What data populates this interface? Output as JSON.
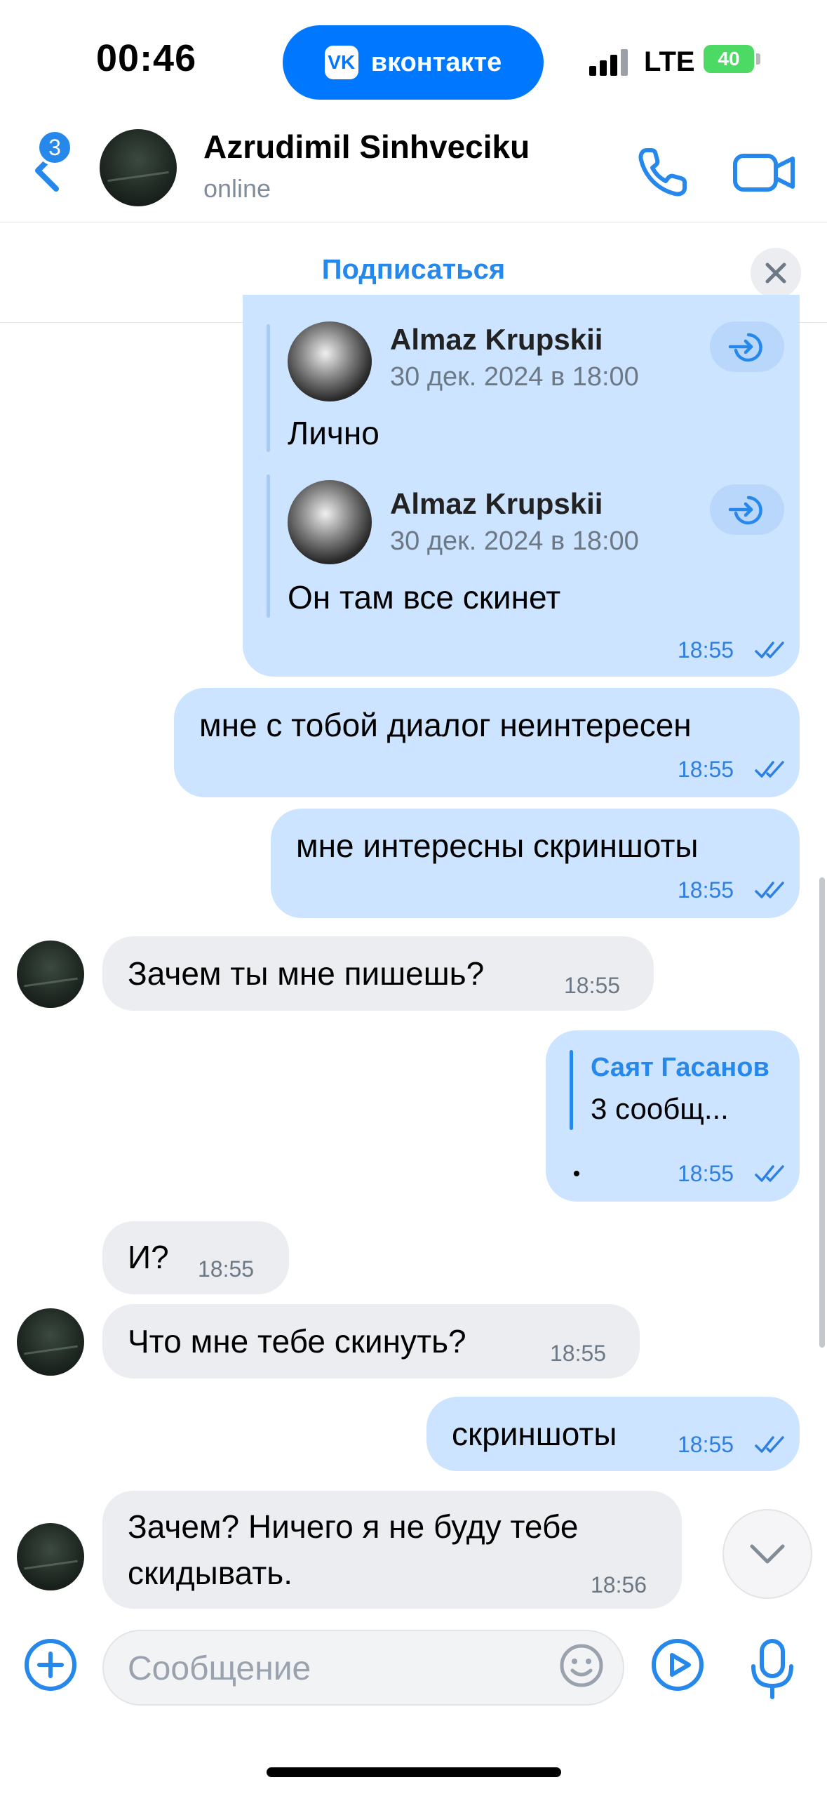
{
  "status_bar": {
    "time": "00:46",
    "app_pill": "вконтакте",
    "network": "LTE",
    "battery": "40"
  },
  "header": {
    "back_badge": "3",
    "contact_name": "Azrudimil Sinhveciku",
    "contact_status": "online"
  },
  "subscribe_bar": {
    "label": "Подписаться"
  },
  "forwarded": [
    {
      "author": "Almaz Krupskii",
      "date": "30 дек. 2024 в 18:00",
      "text": "Лично"
    },
    {
      "author": "Almaz Krupskii",
      "date": "30 дек. 2024 в 18:00",
      "text": "Он там все скинет"
    }
  ],
  "forward_time": "18:55",
  "messages": [
    {
      "dir": "out",
      "text": "мне с тобой диалог неинтересен",
      "time": "18:55"
    },
    {
      "dir": "out",
      "text": "мне интересны скриншоты",
      "time": "18:55"
    },
    {
      "dir": "in",
      "text": "Зачем ты мне пишешь?",
      "time": "18:55"
    },
    {
      "dir": "out",
      "reply_name": "Саят Гасанов",
      "reply_text": "3 сообщ...",
      "time": "18:55"
    },
    {
      "dir": "in",
      "text": "И?",
      "time": "18:55"
    },
    {
      "dir": "in",
      "text": "Что мне тебе скинуть?",
      "time": "18:55"
    },
    {
      "dir": "out",
      "text": "скриншоты",
      "time": "18:55"
    },
    {
      "dir": "in",
      "text": "Зачем? Ничего я не буду тебе скидывать.",
      "time": "18:56"
    }
  ],
  "composer": {
    "placeholder": "Сообщение"
  },
  "colors": {
    "accent": "#2688eb",
    "brand_vk": "#0077ff",
    "outgoing_bubble": "#cce4ff",
    "incoming_bubble": "#ebedf0",
    "battery": "#4cd964"
  },
  "icons": [
    "vk-logo",
    "signal-icon",
    "battery-icon",
    "back-chevron-icon",
    "phone-icon",
    "video-camera-icon",
    "close-icon",
    "share-forward-icon",
    "double-check-icon",
    "chevron-down-icon",
    "plus-icon",
    "emoji-icon",
    "play-icon",
    "microphone-icon"
  ]
}
